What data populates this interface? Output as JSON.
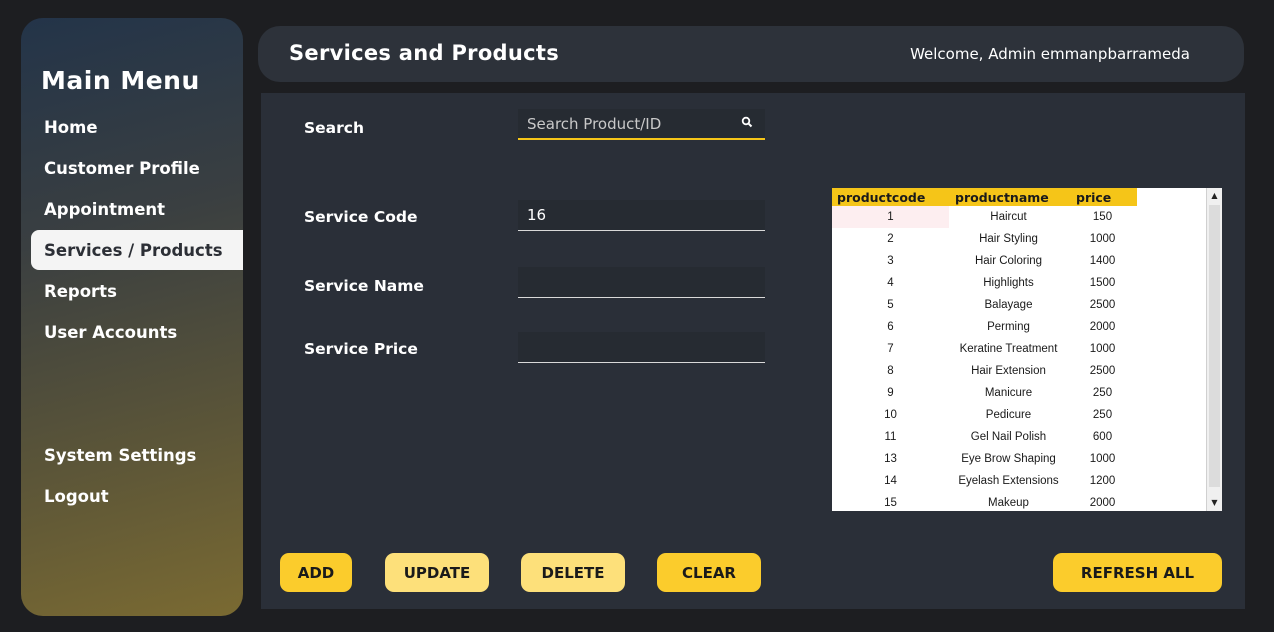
{
  "sidebar": {
    "title": "Main Menu",
    "items": [
      {
        "label": "Home"
      },
      {
        "label": "Customer Profile"
      },
      {
        "label": "Appointment"
      },
      {
        "label": "Services / Products"
      },
      {
        "label": "Reports"
      },
      {
        "label": "User Accounts"
      },
      {
        "label": "System Settings"
      },
      {
        "label": "Logout"
      }
    ],
    "active_index": 3
  },
  "header": {
    "title": "Services and Products",
    "welcome": "Welcome, Admin emmanpbarrameda"
  },
  "form": {
    "search_label": "Search",
    "search_placeholder": "Search Product/ID",
    "code_label": "Service Code",
    "code_value": "16",
    "name_label": "Service Name",
    "name_value": "",
    "price_label": "Service Price",
    "price_value": ""
  },
  "table": {
    "columns": [
      "productcode",
      "productname",
      "price"
    ],
    "rows": [
      [
        "1",
        "Haircut",
        "150"
      ],
      [
        "2",
        "Hair Styling",
        "1000"
      ],
      [
        "3",
        "Hair Coloring",
        "1400"
      ],
      [
        "4",
        "Highlights",
        "1500"
      ],
      [
        "5",
        "Balayage",
        "2500"
      ],
      [
        "6",
        "Perming",
        "2000"
      ],
      [
        "7",
        "Keratine Treatment",
        "1000"
      ],
      [
        "8",
        "Hair Extension",
        "2500"
      ],
      [
        "9",
        "Manicure",
        "250"
      ],
      [
        "10",
        "Pedicure",
        "250"
      ],
      [
        "11",
        "Gel Nail Polish",
        "600"
      ],
      [
        "13",
        "Eye Brow Shaping",
        "1000"
      ],
      [
        "14",
        "Eyelash Extensions",
        "1200"
      ],
      [
        "15",
        "Makeup",
        "2000"
      ]
    ],
    "selected_row": 0
  },
  "buttons": {
    "add": "ADD",
    "update": "UPDATE",
    "delete": "DELETE",
    "clear": "CLEAR",
    "refresh": "REFRESH ALL"
  },
  "colors": {
    "accent": "#fbcc2c",
    "panel": "#2a2f38",
    "background": "#1d1e21"
  }
}
